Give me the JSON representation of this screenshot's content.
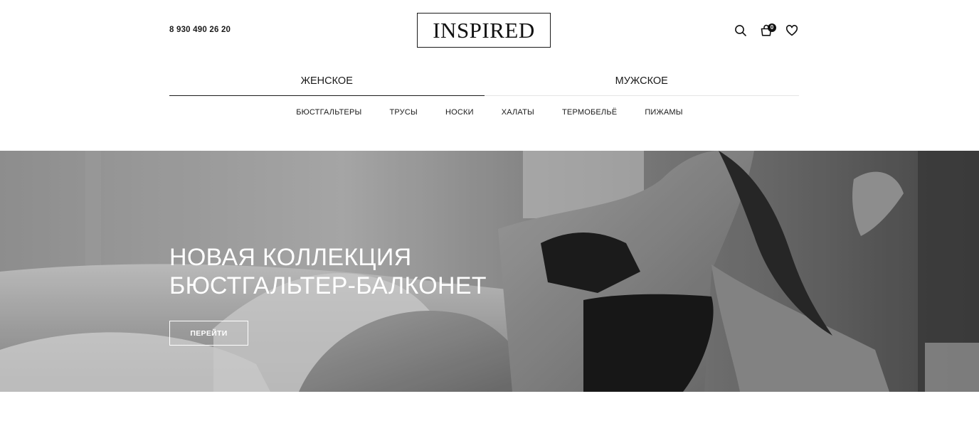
{
  "header": {
    "phone": "8 930 490 26 20",
    "logo": "INSPIRED",
    "icons": [
      "search-icon",
      "cart-icon",
      "heart-icon"
    ],
    "cart_count": "0"
  },
  "gender_tabs": [
    {
      "label": "ЖЕНСКОЕ",
      "active": true
    },
    {
      "label": "МУЖСКОЕ",
      "active": false
    }
  ],
  "categories": [
    "БЮСТГАЛЬТЕРЫ",
    "ТРУСЫ",
    "НОСКИ",
    "ХАЛАТЫ",
    "ТЕРМОБЕЛЬЁ",
    "ПИЖАМЫ"
  ],
  "hero": {
    "title_line1": "НОВАЯ КОЛЛЕКЦИЯ",
    "title_line2": "БЮСТГАЛЬТЕР-БАЛКОНЕТ",
    "button_label": "ПЕРЕЙТИ"
  },
  "colors": {
    "text": "#1a1a1a",
    "background": "#ffffff",
    "hero_text": "#ffffff"
  }
}
